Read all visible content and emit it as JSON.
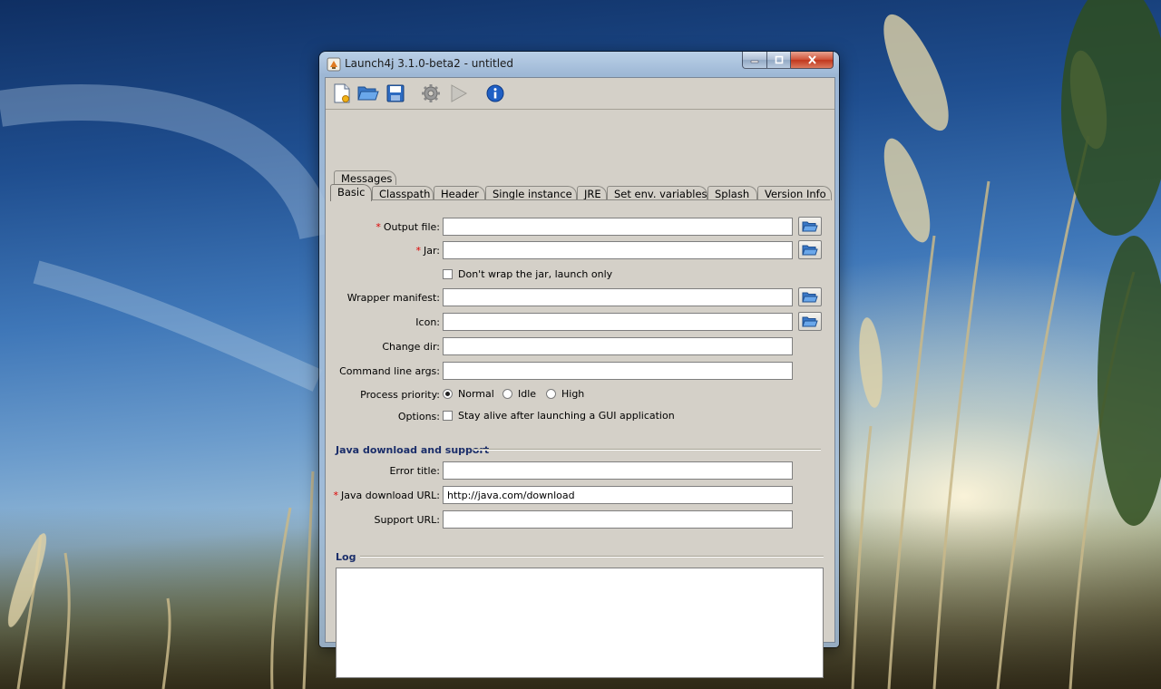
{
  "window": {
    "title": "Launch4j 3.1.0-beta2 - untitled"
  },
  "toolbar": {
    "buttons": [
      "new-config",
      "open-config",
      "save-config",
      "build-wrapper",
      "test-wrapper",
      "about"
    ]
  },
  "tabs": {
    "row_top": [
      "Messages"
    ],
    "row_bottom": [
      "Basic",
      "Classpath",
      "Header",
      "Single instance",
      "JRE",
      "Set env. variables",
      "Splash",
      "Version Info"
    ],
    "active": "Basic"
  },
  "basic": {
    "required_mark": "*",
    "output_file_label": "Output file:",
    "output_file_value": "",
    "jar_label": "Jar:",
    "jar_value": "",
    "dont_wrap_label": "Don't wrap the jar, launch only",
    "dont_wrap_checked": false,
    "wrapper_manifest_label": "Wrapper manifest:",
    "wrapper_manifest_value": "",
    "icon_label": "Icon:",
    "icon_value": "",
    "change_dir_label": "Change dir:",
    "change_dir_value": "",
    "cmd_args_label": "Command line args:",
    "cmd_args_value": "",
    "priority_label": "Process priority:",
    "priority_options": [
      "Normal",
      "Idle",
      "High"
    ],
    "priority_selected": "Normal",
    "options_label": "Options:",
    "stay_alive_label": "Stay alive after launching a GUI application",
    "stay_alive_checked": false
  },
  "java_download": {
    "section_title": "Java download and support",
    "error_title_label": "Error title:",
    "error_title_value": "",
    "download_url_label": "Java download URL:",
    "download_url_value": "http://java.com/download",
    "support_url_label": "Support URL:",
    "support_url_value": ""
  },
  "log": {
    "section_title": "Log",
    "content": ""
  },
  "colors": {
    "dialog_bg": "#d4d0c8",
    "section_title": "#1b2e6a",
    "required": "#dd0000"
  }
}
